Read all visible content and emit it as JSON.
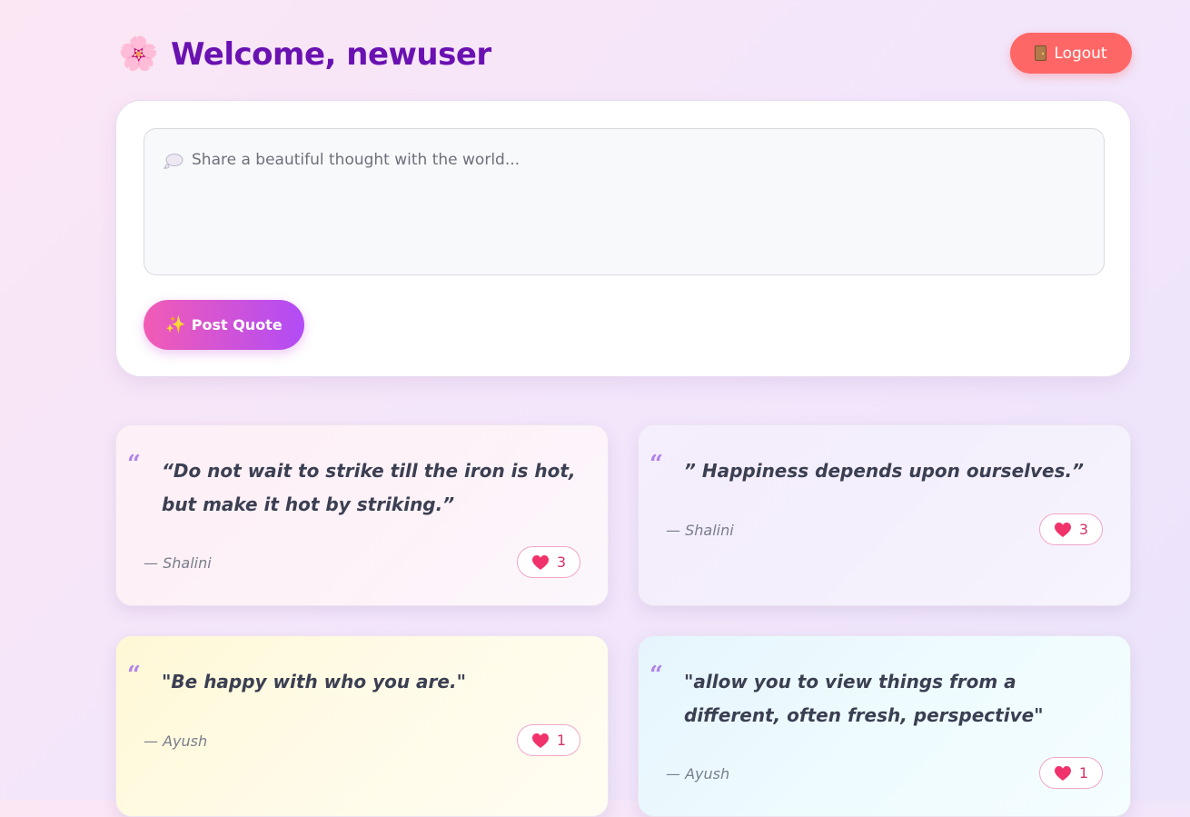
{
  "header": {
    "flower_icon": "🌸",
    "title": "Welcome, newuser",
    "logout_label": "Logout"
  },
  "composer": {
    "placeholder": "Share a beautiful thought with the world...",
    "post_label": "Post Quote",
    "post_icon": "✨"
  },
  "colors": {
    "title": "#6a11b2",
    "logout": "#ff6767",
    "post_gradient_start": "#f25bb5",
    "post_gradient_end": "#b14cf6",
    "like_accent": "#d6336c"
  },
  "quotes": [
    {
      "text": "“Do not wait to strike till the iron is hot, but make it hot by striking.”",
      "author": "— Shalini",
      "likes": "3"
    },
    {
      "text": "” Happiness depends upon ourselves.”",
      "author": "— Shalini",
      "likes": "3"
    },
    {
      "text": "\"Be happy with who you are.\"",
      "author": "— Ayush",
      "likes": "1"
    },
    {
      "text": "\"allow you to view things from a different, often fresh, perspective\"",
      "author": "— Ayush",
      "likes": "1"
    }
  ],
  "icons": {
    "flower": "cherry-blossom-icon",
    "logout": "door-icon",
    "composer": "thought-bubble-icon",
    "post": "sparkles-icon",
    "quote": "quote-mark-icon",
    "like": "heart-icon"
  }
}
